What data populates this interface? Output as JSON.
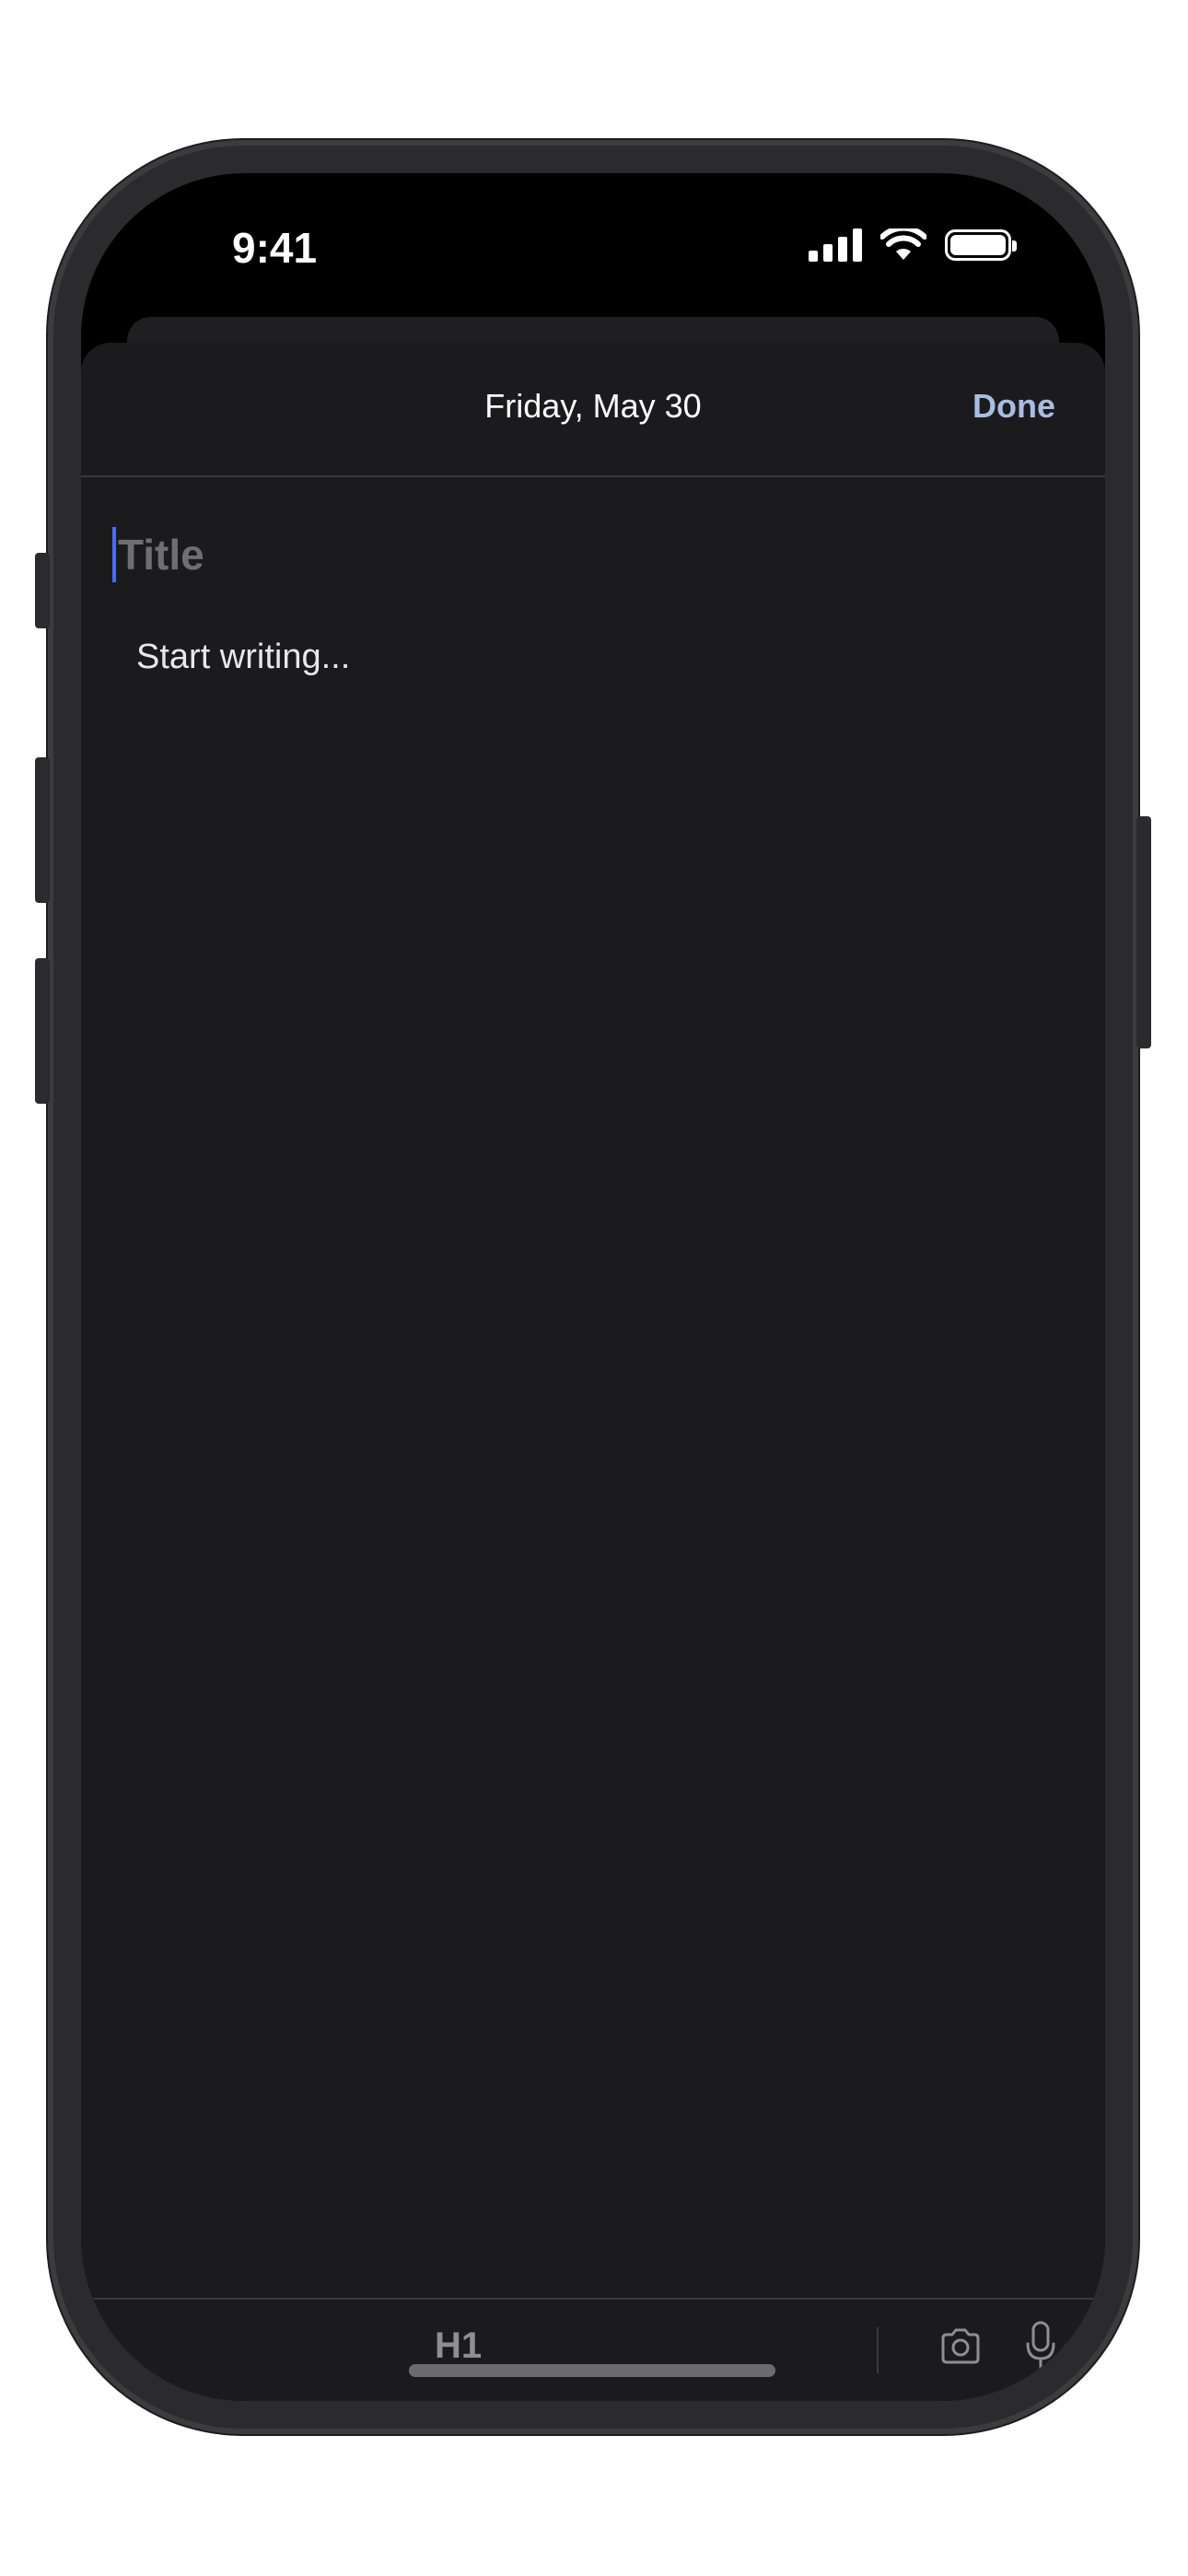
{
  "status_bar": {
    "time": "9:41",
    "icons": [
      "cellular-signal-icon",
      "wifi-icon",
      "battery-icon"
    ]
  },
  "sheet": {
    "date": "Friday, May 30",
    "done_label": "Done"
  },
  "editor": {
    "title_placeholder": "Title",
    "body_placeholder": "Start writing..."
  },
  "toolbar": {
    "heading_label": "H1",
    "icons": [
      "camera-icon",
      "microphone-icon"
    ]
  },
  "colors": {
    "accent": "#a9bde3",
    "caret": "#4a6cf7",
    "sheet_background": "#1b1b1d",
    "placeholder": "#6e6e73"
  }
}
